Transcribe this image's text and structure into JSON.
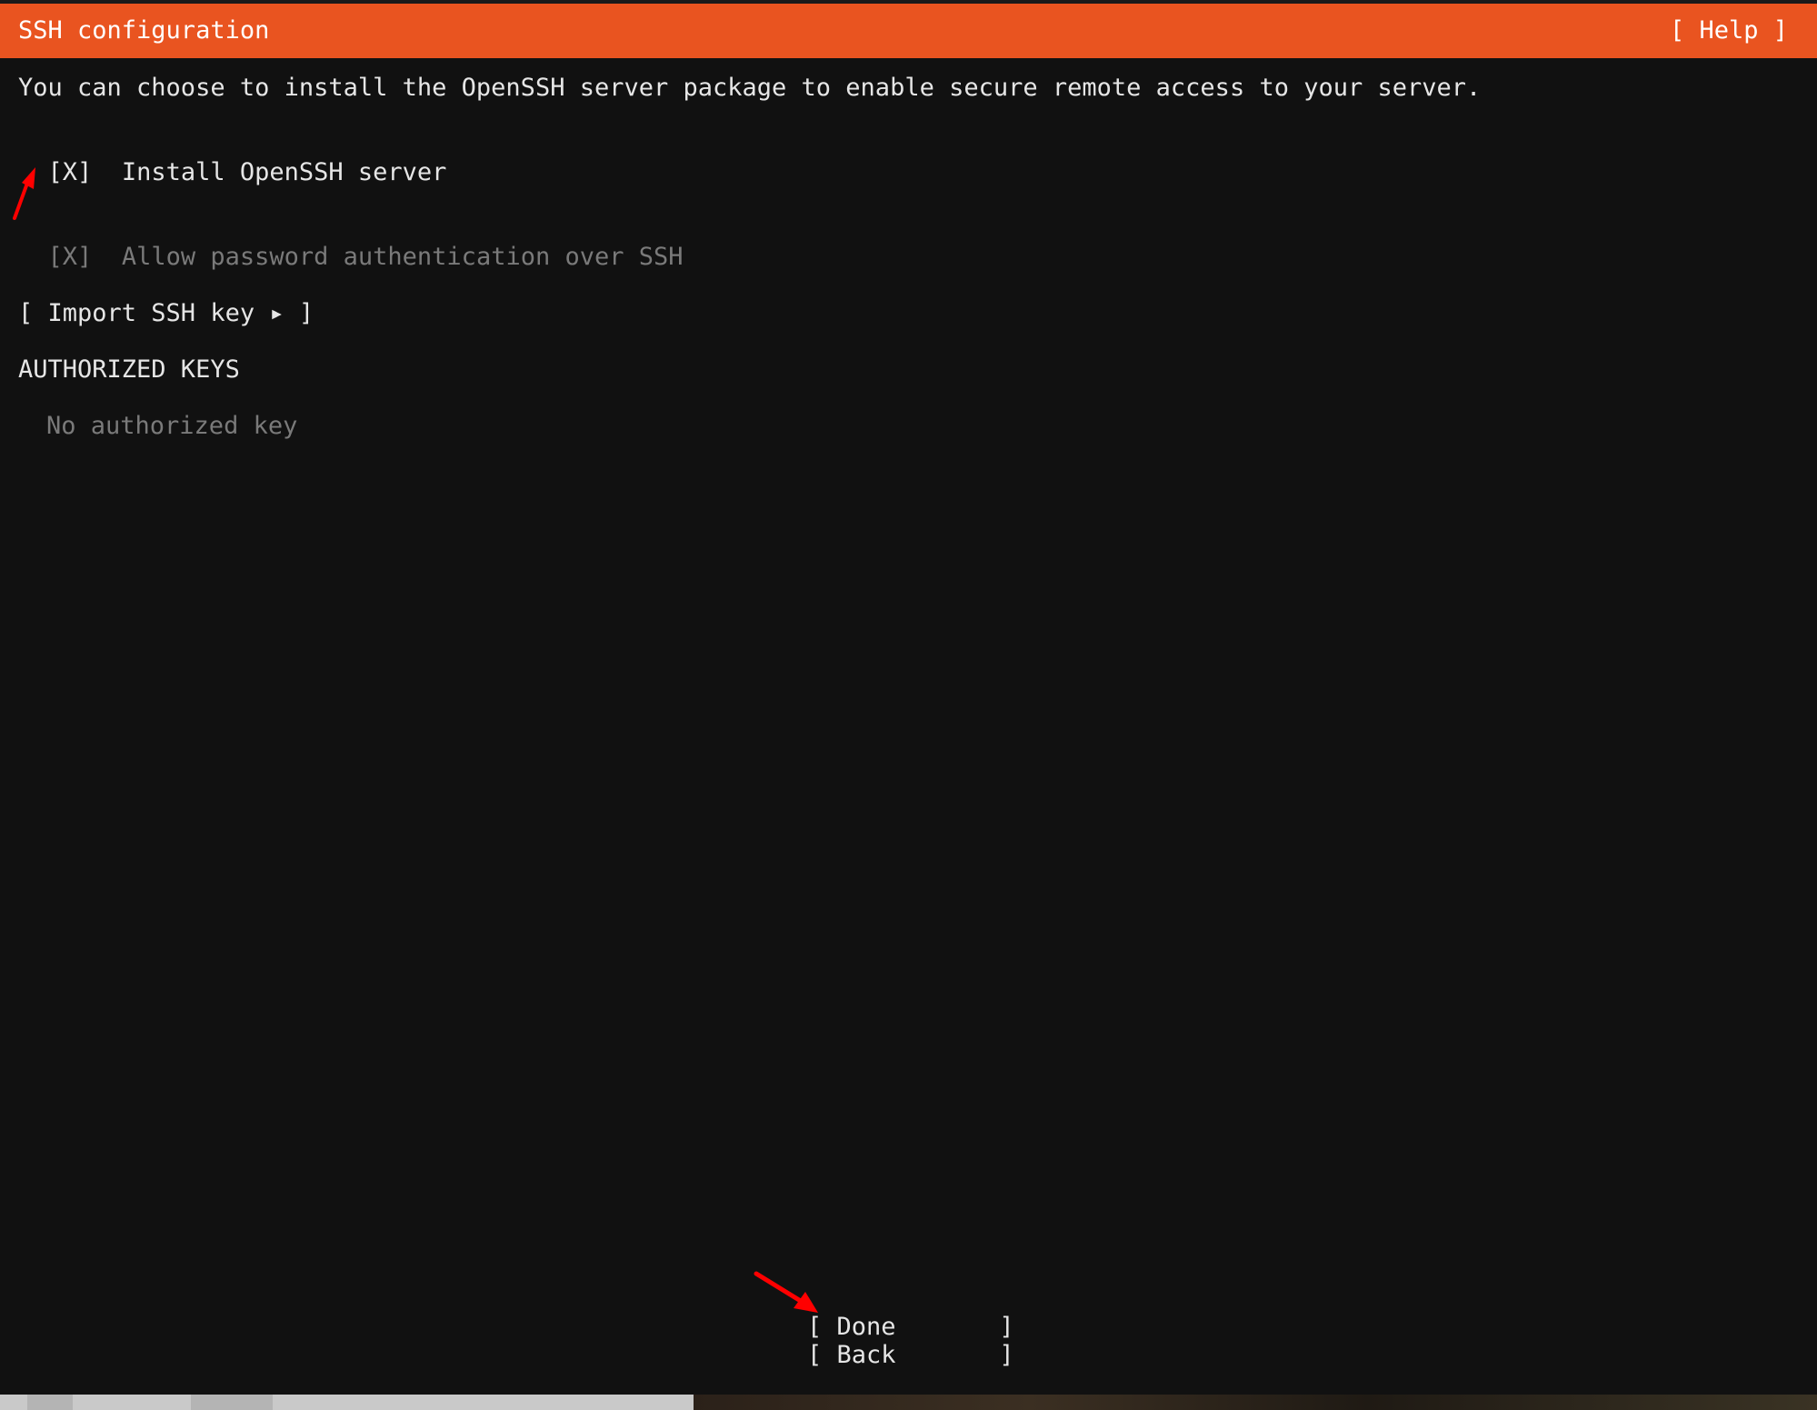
{
  "header": {
    "title": "SSH configuration",
    "help_label": "[ Help ]"
  },
  "description": "You can choose to install the OpenSSH server package to enable secure remote access to your server.",
  "options": {
    "install_openssh": {
      "checkbox": "[X]",
      "label": "Install OpenSSH server",
      "checked": true
    },
    "allow_password_auth": {
      "checkbox": "[X]",
      "label": "Allow password authentication over SSH",
      "checked": true,
      "disabled": true
    }
  },
  "import_button": {
    "label": "[ Import SSH key ▸ ]"
  },
  "authorized_keys": {
    "heading": "AUTHORIZED KEYS",
    "empty_text": "No authorized key"
  },
  "footer": {
    "done_label": "[ Done       ]",
    "back_label": "[ Back       ]"
  },
  "colors": {
    "header_bg": "#e95420",
    "background": "#111111",
    "text": "#e6e6e6",
    "disabled_text": "#7a7a7a",
    "annotation_arrow": "#ff0000"
  },
  "icons": {
    "import_arrow": "play-triangle-icon",
    "annotations": [
      "red-arrow-icon",
      "red-arrow-icon"
    ]
  }
}
